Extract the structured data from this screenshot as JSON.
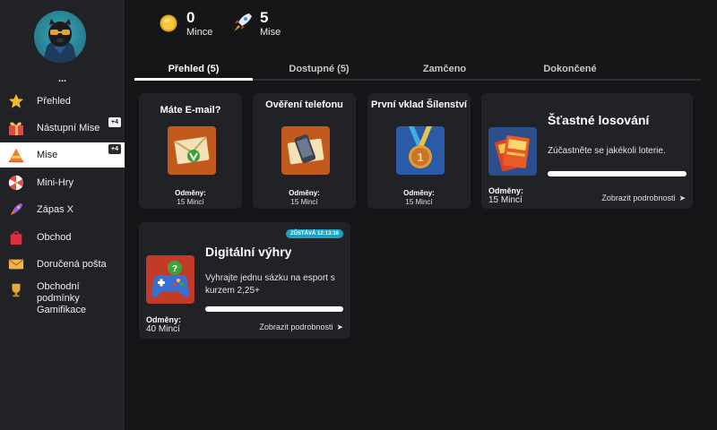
{
  "user": {
    "name": "..."
  },
  "sidebar": {
    "items": [
      {
        "label": "Přehled",
        "icon": "star-icon"
      },
      {
        "label": "Nástupní Mise",
        "icon": "gift-icon",
        "badge": "+4"
      },
      {
        "label": "Mise",
        "icon": "cone-icon",
        "badge": "+4",
        "active": true
      },
      {
        "label": "Mini-Hry",
        "icon": "wheel-icon"
      },
      {
        "label": "Zápas X",
        "icon": "rocket-icon"
      },
      {
        "label": "Obchod",
        "icon": "shopping-bag-icon"
      },
      {
        "label": "Doručená pošta",
        "icon": "envelope-icon"
      },
      {
        "label": "Obchodní podmínky Gamifikace",
        "icon": "trophy-icon"
      }
    ]
  },
  "header": {
    "coins": {
      "value": "0",
      "label": "Mince",
      "icon": "coin-icon"
    },
    "missions": {
      "value": "5",
      "label": "Mise",
      "icon": "rocket-icon"
    }
  },
  "tabs": [
    {
      "label": "Přehled (5)",
      "active": true
    },
    {
      "label": "Dostupné (5)"
    },
    {
      "label": "Zamčeno"
    },
    {
      "label": "Dokončené"
    }
  ],
  "missions": [
    {
      "title": "Máte E-mail?",
      "reward_label": "Odměny:",
      "reward": "15 Mincí",
      "icon": "email-envelope-icon"
    },
    {
      "title": "Ověření telefonu",
      "reward_label": "Odměny:",
      "reward": "15 Mincí",
      "icon": "phone-envelope-icon"
    },
    {
      "title": "První vklad Šílenství",
      "reward_label": "Odměny:",
      "reward": "15 Mincí",
      "icon": "medal-icon"
    }
  ],
  "lottery": {
    "title": "Šťastné losování",
    "description": "Zúčastněte se jakékoli loterie.",
    "reward_label": "Odměny:",
    "reward": "15 Mincí",
    "link": "Zobrazit podrobnosti",
    "progress": 1.0,
    "icon": "lottery-tickets-icon"
  },
  "digital": {
    "title": "Digitální výhry",
    "description": "Vyhrajte jednu sázku na esport s kurzem 2,25+",
    "reward_label": "Odměny:",
    "reward": "40 Mincí",
    "link": "Zobrazit podrobnosti",
    "timer": "ZŮSTÁVÁ 12:13:16",
    "progress": 1.0,
    "icon": "gamepad-icon"
  },
  "colors": {
    "background": "#141517",
    "panel": "#212226",
    "accent": "#1aa3c4",
    "active_item": "#ffffff"
  }
}
